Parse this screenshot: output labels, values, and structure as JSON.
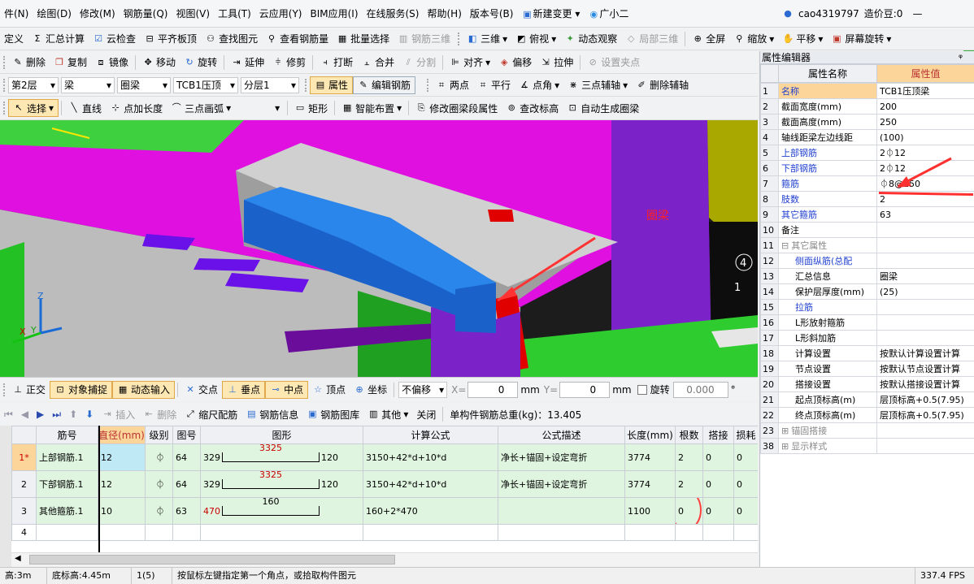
{
  "menu": [
    "件(N)",
    "绘图(D)",
    "修改(M)",
    "钢筋量(Q)",
    "视图(V)",
    "工具(T)",
    "云应用(Y)",
    "BIM应用(I)",
    "在线服务(S)",
    "帮助(H)",
    "版本号(B)",
    "新建变更",
    "广小二"
  ],
  "user": {
    "name": "cao4319797",
    "coins": "造价豆:0",
    "badge": "49"
  },
  "toolbar1": [
    "定义",
    "汇总计算",
    "云检查",
    "平齐板顶",
    "查找图元",
    "查看钢筋量",
    "批量选择",
    "钢筋三维",
    "三维",
    "俯视",
    "动态观察",
    "局部三维",
    "全屏",
    "缩放",
    "平移",
    "屏幕旋转"
  ],
  "toolbar2": [
    "删除",
    "复制",
    "镜像",
    "移动",
    "旋转",
    "延伸",
    "修剪",
    "打断",
    "合并",
    "分割",
    "对齐",
    "偏移",
    "拉伸",
    "设置夹点"
  ],
  "toolbar3": {
    "floor": "第2层",
    "type": "梁",
    "subtype": "圈梁",
    "element": "TCB1压顶",
    "layer": "分层1",
    "attr": "属性",
    "edit_rebar": "编辑钢筋",
    "tools": [
      "两点",
      "平行",
      "点角",
      "三点辅轴",
      "删除辅轴"
    ]
  },
  "toolbar4": [
    "选择",
    "直线",
    "点加长度",
    "三点画弧",
    "矩形",
    "智能布置",
    "修改圈梁段属性",
    "查改标高",
    "自动生成圈梁"
  ],
  "viewport": {
    "label": "圈梁",
    "axis_x": "X",
    "axis_y": "Y",
    "axis_z": "Z",
    "markers": [
      "4",
      "4",
      "1"
    ]
  },
  "snapbar": {
    "items": [
      "正交",
      "对象捕捉",
      "动态输入",
      "交点",
      "垂点",
      "中点",
      "顶点",
      "坐标"
    ],
    "offset": "不偏移",
    "x_label": "X=",
    "x_value": "0",
    "y_label": "Y=",
    "y_value": "0",
    "unit": "mm",
    "rotate": "旋转",
    "rotate_value": "0.000",
    "deg": "°"
  },
  "gridtb": {
    "items": [
      "插入",
      "删除",
      "缩尺配筋",
      "钢筋信息",
      "钢筋图库",
      "其他",
      "关闭"
    ],
    "total_label": "单构件钢筋总重(kg)：13.405"
  },
  "table": {
    "headers": [
      "筋号",
      "直径(mm)",
      "级别",
      "图号",
      "图形",
      "计算公式",
      "公式描述",
      "长度(mm)",
      "根数",
      "搭接",
      "损耗"
    ],
    "rows": [
      {
        "rh": "1*",
        "name": "上部钢筋.1",
        "dia": "12",
        "grade": "⏀",
        "fig": "64",
        "left": "329",
        "mid": "3325",
        "right": "120",
        "formula": "3150+42*d+10*d",
        "desc": "净长+锚固+设定弯折",
        "len": "3774",
        "count": "2",
        "lap": "0",
        "loss": "0"
      },
      {
        "rh": "2",
        "name": "下部钢筋.1",
        "dia": "12",
        "grade": "⏀",
        "fig": "64",
        "left": "329",
        "mid": "3325",
        "right": "120",
        "formula": "3150+42*d+10*d",
        "desc": "净长+锚固+设定弯折",
        "len": "3774",
        "count": "2",
        "lap": "0",
        "loss": "0"
      },
      {
        "rh": "3",
        "name": "其他箍筋.1",
        "dia": "10",
        "grade": "⏀",
        "fig": "63",
        "left": "470",
        "mid": "160",
        "right": "",
        "formula": "160+2*470",
        "desc": "",
        "len": "1100",
        "count": "0",
        "lap": "0",
        "loss": "0"
      }
    ],
    "empty_row": "4"
  },
  "status": [
    "高:3m",
    "底标高:4.45m",
    "1(5)",
    "按鼠标左键指定第一个角点，或拾取构件图元",
    "337.4 FPS"
  ],
  "props": {
    "title": "属性编辑器",
    "pin": "ᵠ",
    "col_name": "属性名称",
    "col_value": "属性值",
    "rows": [
      {
        "i": "1",
        "n": "名称",
        "v": "TCB1压顶梁",
        "cls": "sel"
      },
      {
        "i": "2",
        "n": "截面宽度(mm)",
        "v": "200",
        "cls": ""
      },
      {
        "i": "3",
        "n": "截面高度(mm)",
        "v": "250",
        "cls": ""
      },
      {
        "i": "4",
        "n": "轴线距梁左边线距",
        "v": "(100)",
        "cls": ""
      },
      {
        "i": "5",
        "n": "上部钢筋",
        "v": "2⏀12",
        "cls": "blue"
      },
      {
        "i": "6",
        "n": "下部钢筋",
        "v": "2⏀12",
        "cls": "blue"
      },
      {
        "i": "7",
        "n": "箍筋",
        "v": "⏀8@150",
        "cls": "blue"
      },
      {
        "i": "8",
        "n": "肢数",
        "v": "2",
        "cls": "blue"
      },
      {
        "i": "9",
        "n": "其它箍筋",
        "v": "63",
        "cls": "blue"
      },
      {
        "i": "10",
        "n": "备注",
        "v": "",
        "cls": ""
      },
      {
        "i": "11",
        "n": "其它属性",
        "v": "",
        "cls": "grey",
        "group": "⊟"
      },
      {
        "i": "12",
        "n": "侧面纵筋(总配",
        "v": "",
        "cls": "blue",
        "tree": true
      },
      {
        "i": "13",
        "n": "汇总信息",
        "v": "圈梁",
        "cls": "",
        "tree": true
      },
      {
        "i": "14",
        "n": "保护层厚度(mm)",
        "v": "(25)",
        "cls": "",
        "tree": true
      },
      {
        "i": "15",
        "n": "拉筋",
        "v": "",
        "cls": "blue",
        "tree": true
      },
      {
        "i": "16",
        "n": "L形放射箍筋",
        "v": "",
        "cls": "",
        "tree": true
      },
      {
        "i": "17",
        "n": "L形斜加筋",
        "v": "",
        "cls": "",
        "tree": true
      },
      {
        "i": "18",
        "n": "计算设置",
        "v": "按默认计算设置计算",
        "cls": "",
        "tree": true
      },
      {
        "i": "19",
        "n": "节点设置",
        "v": "按默认节点设置计算",
        "cls": "",
        "tree": true
      },
      {
        "i": "20",
        "n": "搭接设置",
        "v": "按默认搭接设置计算",
        "cls": "",
        "tree": true
      },
      {
        "i": "21",
        "n": "起点顶标高(m)",
        "v": "层顶标高+0.5(7.95)",
        "cls": "",
        "tree": true
      },
      {
        "i": "22",
        "n": "终点顶标高(m)",
        "v": "层顶标高+0.5(7.95)",
        "cls": "",
        "tree": true
      },
      {
        "i": "23",
        "n": "锚固搭接",
        "v": "",
        "cls": "grey",
        "group": "⊞"
      },
      {
        "i": "38",
        "n": "显示样式",
        "v": "",
        "cls": "grey",
        "group": "⊞"
      }
    ]
  }
}
